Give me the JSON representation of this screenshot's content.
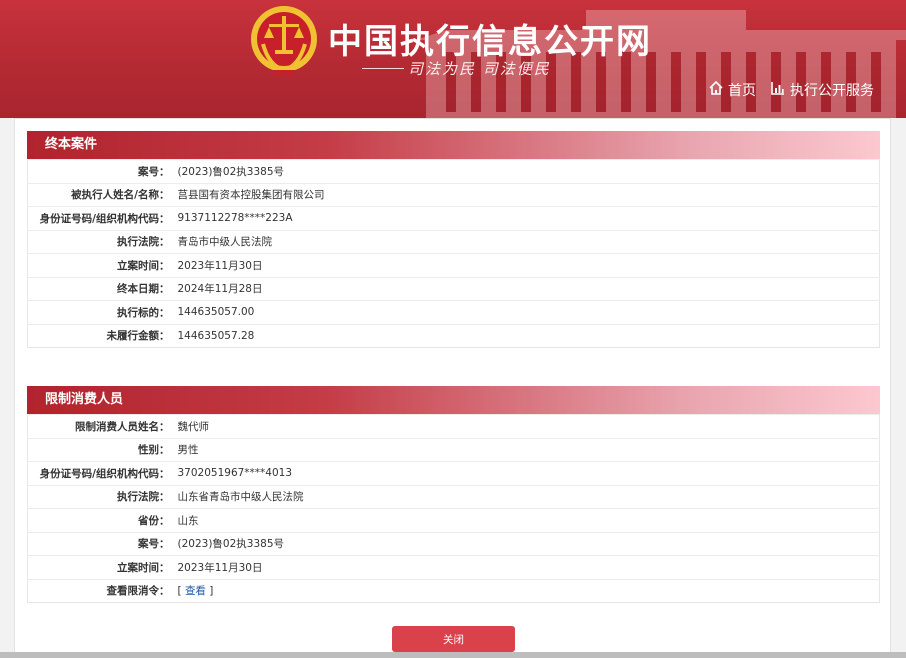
{
  "header": {
    "site_title": "中国执行信息公开网",
    "slogan": "司法为民  司法便民",
    "nav": [
      {
        "label": "首页",
        "icon": "home-icon"
      },
      {
        "label": "执行公开服务",
        "icon": "chart-icon"
      }
    ]
  },
  "terminated_case": {
    "title": "终本案件",
    "rows": [
      {
        "label": "案号：",
        "value": "(2023)鲁02执3385号"
      },
      {
        "label": "被执行人姓名/名称：",
        "value": "莒县国有资本控股集团有限公司"
      },
      {
        "label": "身份证号码/组织机构代码：",
        "value": "9137112278****223A"
      },
      {
        "label": "执行法院：",
        "value": "青岛市中级人民法院"
      },
      {
        "label": "立案时间：",
        "value": "2023年11月30日"
      },
      {
        "label": "终本日期：",
        "value": "2024年11月28日"
      },
      {
        "label": "执行标的：",
        "value": "144635057.00"
      },
      {
        "label": "未履行金额：",
        "value": "144635057.28"
      }
    ]
  },
  "restricted_person": {
    "title": "限制消费人员",
    "rows": [
      {
        "label": "限制消费人员姓名：",
        "value": "魏代师"
      },
      {
        "label": "性别：",
        "value": "男性"
      },
      {
        "label": "身份证号码/组织机构代码：",
        "value": "3702051967****4013"
      },
      {
        "label": "执行法院：",
        "value": "山东省青岛市中级人民法院"
      },
      {
        "label": "省份：",
        "value": "山东"
      },
      {
        "label": "案号：",
        "value": "(2023)鲁02执3385号"
      },
      {
        "label": "立案时间：",
        "value": "2023年11月30日"
      }
    ],
    "order_row": {
      "label": "查看限消令：",
      "link_open": "[ ",
      "link_text": "查看",
      "link_close": " ]"
    }
  },
  "close_button": {
    "label": "关闭"
  },
  "colors": {
    "header_red": "#b42a33",
    "section_header": "#b1232d",
    "button_red": "#d9414b",
    "link_blue": "#1f5aa6"
  }
}
